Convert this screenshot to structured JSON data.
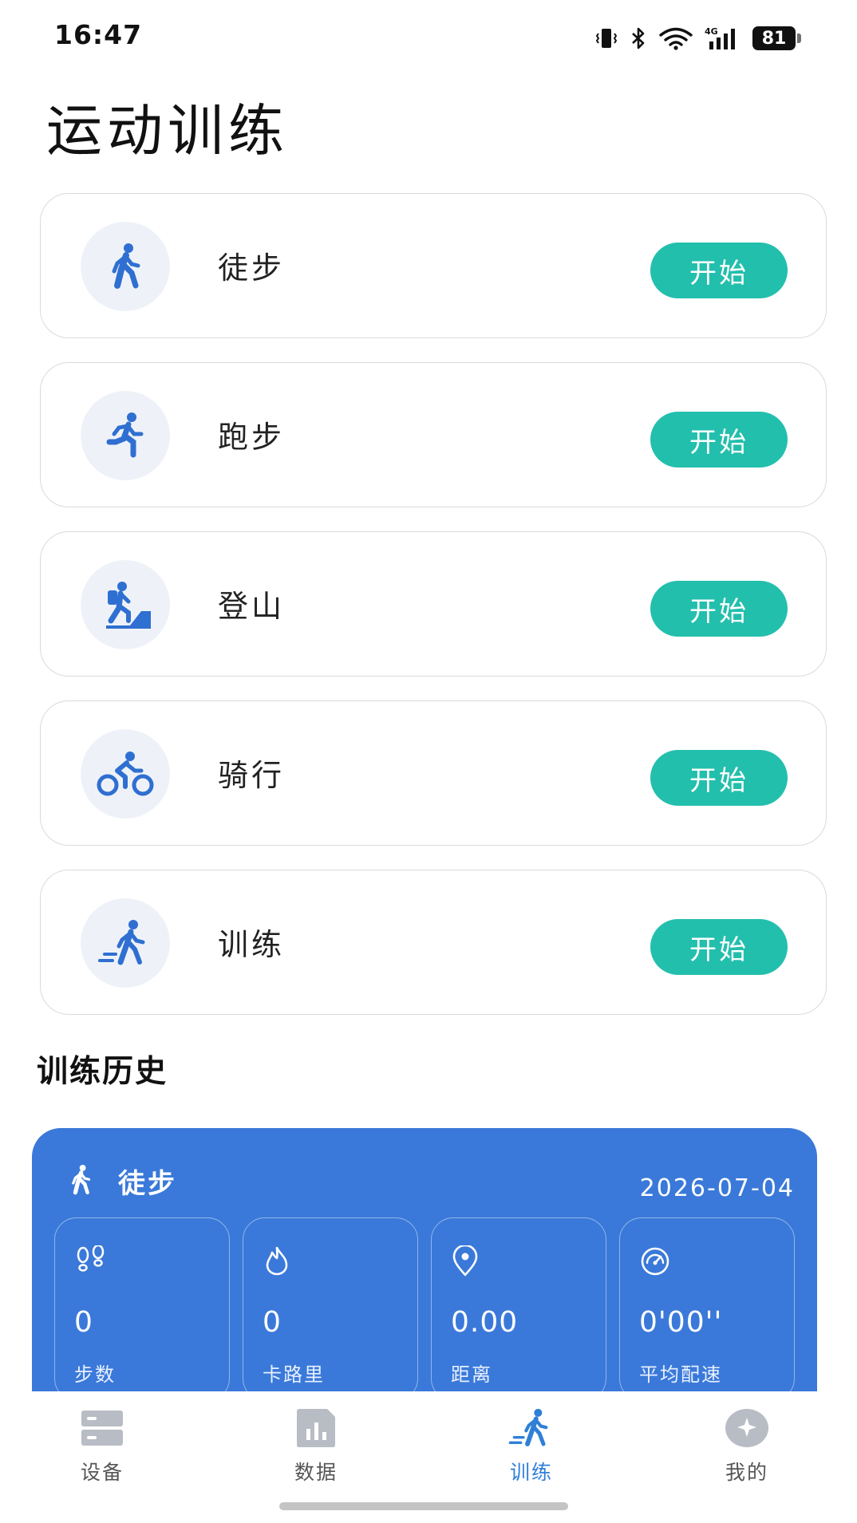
{
  "status_bar": {
    "time": "16:47",
    "battery": "81",
    "network": "4G"
  },
  "page_title": "运动训练",
  "sports": [
    {
      "name": "徒步",
      "icon": "walk-icon",
      "button": "开始"
    },
    {
      "name": "跑步",
      "icon": "run-icon",
      "button": "开始"
    },
    {
      "name": "登山",
      "icon": "climb-icon",
      "button": "开始"
    },
    {
      "name": "骑行",
      "icon": "cycle-icon",
      "button": "开始"
    },
    {
      "name": "训练",
      "icon": "training-icon",
      "button": "开始"
    }
  ],
  "history": {
    "title": "训练历史",
    "card": {
      "sport": "徒步",
      "date": "2026-07-04",
      "stats": [
        {
          "value": "0",
          "label": "步数",
          "icon": "footprints-icon"
        },
        {
          "value": "0",
          "label": "卡路里",
          "icon": "flame-icon"
        },
        {
          "value": "0.00",
          "label": "距离",
          "icon": "location-pin-icon"
        },
        {
          "value": "0'00''",
          "label": "平均配速",
          "icon": "speedometer-icon"
        }
      ]
    }
  },
  "tabs": [
    {
      "label": "设备",
      "icon": "device-icon",
      "active": false
    },
    {
      "label": "数据",
      "icon": "chart-icon",
      "active": false
    },
    {
      "label": "训练",
      "icon": "training-tab-icon",
      "active": true
    },
    {
      "label": "我的",
      "icon": "profile-icon",
      "active": false
    }
  ],
  "colors": {
    "accent": "#23bfad",
    "primary_blue": "#3a79d9",
    "icon_blue": "#2f6fd1",
    "tab_active": "#2f7fd8",
    "tab_inactive": "#b8bcc4"
  }
}
